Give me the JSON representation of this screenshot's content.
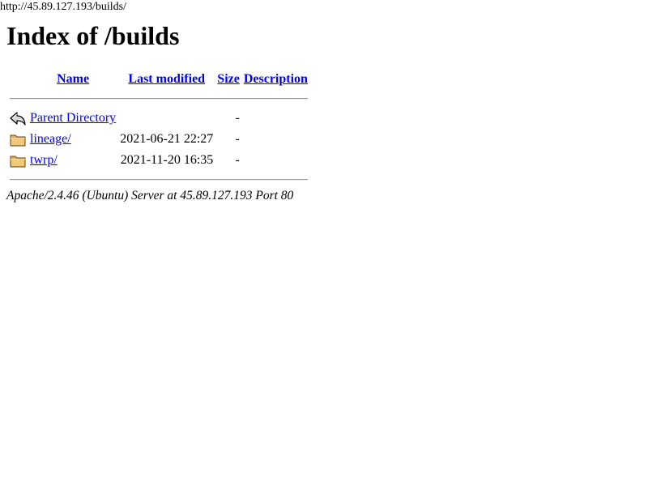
{
  "address_bar": {
    "url": "http://45.89.127.193/builds/"
  },
  "page": {
    "title": "Index of /builds"
  },
  "table": {
    "headers": {
      "name": "Name",
      "last_modified": "Last modified",
      "size": "Size",
      "description": "Description"
    },
    "rows": [
      {
        "icon": "parent-directory-icon",
        "name": "Parent Directory",
        "last_modified": "",
        "size": "-",
        "description": ""
      },
      {
        "icon": "folder-icon",
        "name": "lineage/",
        "last_modified": "2021-06-21 22:27",
        "size": "-",
        "description": ""
      },
      {
        "icon": "folder-icon",
        "name": "twrp/",
        "last_modified": "2021-11-20 16:35",
        "size": "-",
        "description": ""
      }
    ]
  },
  "footer": {
    "server_signature": "Apache/2.4.46 (Ubuntu) Server at 45.89.127.193 Port 80"
  },
  "colors": {
    "link": "#0000ee",
    "text": "#000000",
    "background": "#ffffff",
    "folder": "#e0b060"
  }
}
